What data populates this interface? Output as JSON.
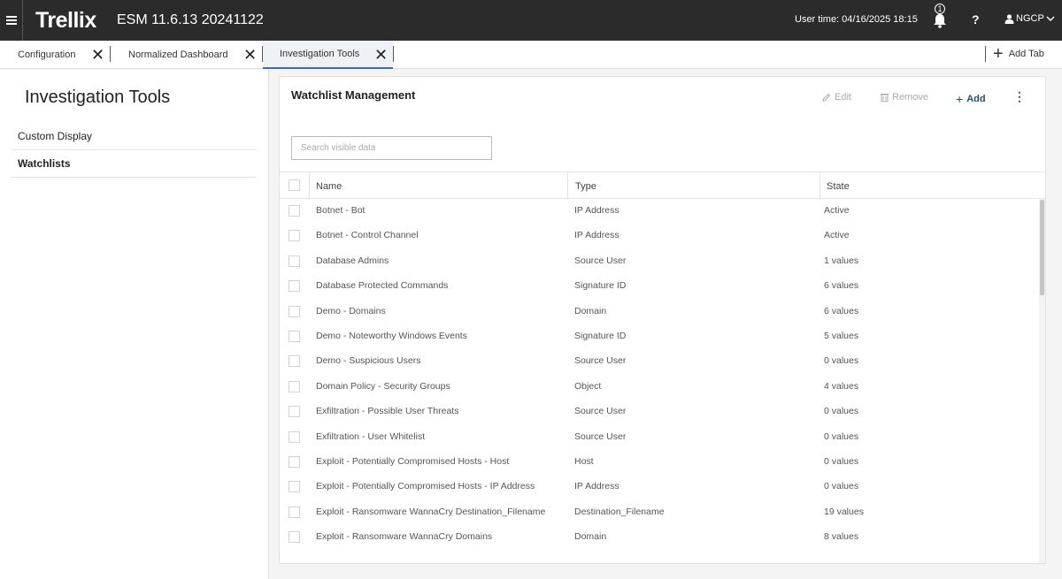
{
  "header": {
    "menu_icon": "hamburger-icon",
    "logo": "Trellix",
    "product": "ESM  11.6.13 20241122",
    "user_time": "User time: 04/16/2025 18:15",
    "notification_count": "1",
    "help": "?",
    "user": "NGCP"
  },
  "tabs": [
    {
      "label": "Configuration"
    },
    {
      "label": "Normalized Dashboard"
    },
    {
      "label": "Investigation Tools"
    }
  ],
  "add_tab": "Add Tab",
  "sidebar": {
    "title": "Investigation Tools",
    "items": [
      {
        "label": "Custom Display"
      },
      {
        "label": "Watchlists"
      }
    ]
  },
  "main": {
    "title": "Watchlist Management",
    "actions": {
      "edit": "Edit",
      "remove": "Remove",
      "add": "Add"
    },
    "search_placeholder": "Search visible data",
    "columns": {
      "name": "Name",
      "type": "Type",
      "state": "State"
    },
    "rows": [
      {
        "name": "Botnet - Bot",
        "type": "IP Address",
        "state": "Active"
      },
      {
        "name": "Botnet - Control Channel",
        "type": "IP Address",
        "state": "Active"
      },
      {
        "name": "Database Admins",
        "type": "Source User",
        "state": "1 values"
      },
      {
        "name": "Database Protected Commands",
        "type": "Signature ID",
        "state": "6 values"
      },
      {
        "name": "Demo - Domains",
        "type": "Domain",
        "state": "6 values"
      },
      {
        "name": "Demo - Noteworthy Windows Events",
        "type": "Signature ID",
        "state": "5 values"
      },
      {
        "name": "Demo - Suspicious Users",
        "type": "Source User",
        "state": "0 values"
      },
      {
        "name": "Domain Policy - Security Groups",
        "type": "Object",
        "state": "4 values"
      },
      {
        "name": "Exfiltration - Possible User Threats",
        "type": "Source User",
        "state": "0 values"
      },
      {
        "name": "Exfiltration - User Whitelist",
        "type": "Source User",
        "state": "0 values"
      },
      {
        "name": "Exploit - Potentially Compromised Hosts - Host",
        "type": "Host",
        "state": "0 values"
      },
      {
        "name": "Exploit - Potentially Compromised Hosts - IP Address",
        "type": "IP Address",
        "state": "0 values"
      },
      {
        "name": "Exploit - Ransomware WannaCry Destination_Filename",
        "type": "Destination_Filename",
        "state": "19 values"
      },
      {
        "name": "Exploit - Ransomware WannaCry Domains",
        "type": "Domain",
        "state": "8 values"
      }
    ]
  },
  "colors": {
    "topbar": "#2b2b2b",
    "accent": "#1f4e79",
    "active_tab": "#3b6ea8"
  }
}
